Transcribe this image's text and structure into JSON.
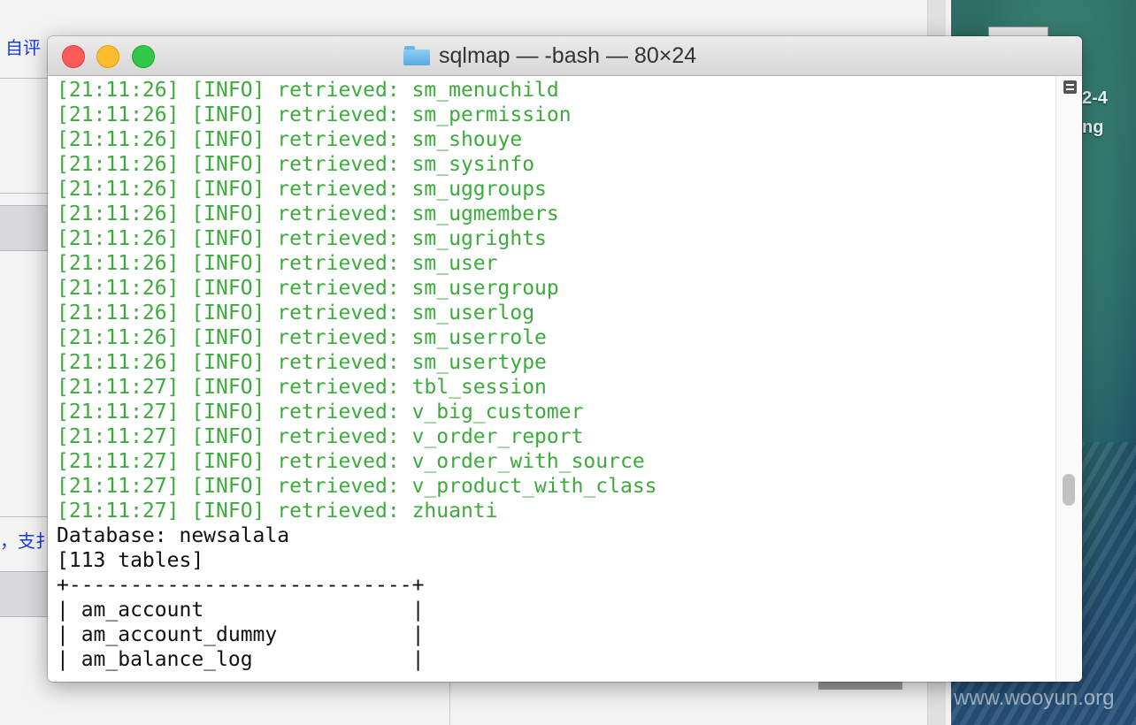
{
  "background": {
    "text_top": "自评",
    "text_bottom": "，支扌"
  },
  "desktop": {
    "label_line1": "2-4",
    "label_line2": "ng",
    "watermark": "www.wooyun.org"
  },
  "terminal": {
    "title": "sqlmap — -bash — 80×24",
    "lines": [
      {
        "text": "[21:11:26] [INFO] retrieved: sm_menuchild",
        "style": "green"
      },
      {
        "text": "[21:11:26] [INFO] retrieved: sm_permission",
        "style": "green"
      },
      {
        "text": "[21:11:26] [INFO] retrieved: sm_shouye",
        "style": "green"
      },
      {
        "text": "[21:11:26] [INFO] retrieved: sm_sysinfo",
        "style": "green"
      },
      {
        "text": "[21:11:26] [INFO] retrieved: sm_uggroups",
        "style": "green"
      },
      {
        "text": "[21:11:26] [INFO] retrieved: sm_ugmembers",
        "style": "green"
      },
      {
        "text": "[21:11:26] [INFO] retrieved: sm_ugrights",
        "style": "green"
      },
      {
        "text": "[21:11:26] [INFO] retrieved: sm_user",
        "style": "green"
      },
      {
        "text": "[21:11:26] [INFO] retrieved: sm_usergroup",
        "style": "green"
      },
      {
        "text": "[21:11:26] [INFO] retrieved: sm_userlog",
        "style": "green"
      },
      {
        "text": "[21:11:26] [INFO] retrieved: sm_userrole",
        "style": "green"
      },
      {
        "text": "[21:11:26] [INFO] retrieved: sm_usertype",
        "style": "green"
      },
      {
        "text": "[21:11:27] [INFO] retrieved: tbl_session",
        "style": "green"
      },
      {
        "text": "[21:11:27] [INFO] retrieved: v_big_customer",
        "style": "green"
      },
      {
        "text": "[21:11:27] [INFO] retrieved: v_order_report",
        "style": "green"
      },
      {
        "text": "[21:11:27] [INFO] retrieved: v_order_with_source",
        "style": "green"
      },
      {
        "text": "[21:11:27] [INFO] retrieved: v_product_with_class",
        "style": "green"
      },
      {
        "text": "[21:11:27] [INFO] retrieved: zhuanti",
        "style": "green"
      },
      {
        "text": "Database: newsalala",
        "style": "plain"
      },
      {
        "text": "[113 tables]",
        "style": "plain"
      },
      {
        "text": "+----------------------------+",
        "style": "plain"
      },
      {
        "text": "| am_account                 |",
        "style": "plain"
      },
      {
        "text": "| am_account_dummy           |",
        "style": "plain"
      },
      {
        "text": "| am_balance_log             |",
        "style": "plain"
      }
    ]
  },
  "colors": {
    "info_green": "#3cab3c",
    "close": "#fc5b57",
    "minimize": "#fdbc2e",
    "maximize": "#33c748"
  }
}
